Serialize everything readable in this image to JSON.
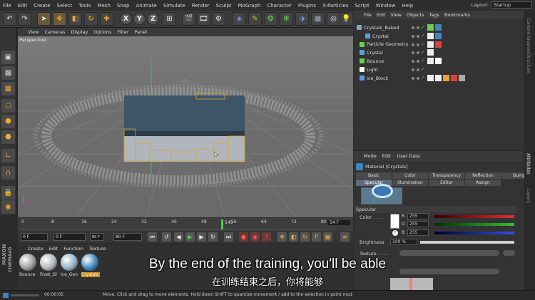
{
  "menubar": {
    "items": [
      "File",
      "Edit",
      "Create",
      "Select",
      "Tools",
      "Mesh",
      "Snap",
      "Animate",
      "Simulate",
      "Render",
      "Sculpt",
      "MoGraph",
      "Character",
      "Plugins",
      "X-Particles",
      "Script",
      "Window",
      "Help"
    ]
  },
  "layout": {
    "label": "Layout:",
    "value": "Startup"
  },
  "toolbar": {
    "x": "X",
    "y": "Y",
    "z": "Z"
  },
  "viewport": {
    "menu": [
      "View",
      "Cameras",
      "Display",
      "Options",
      "Filter",
      "Panel"
    ],
    "label": "Perspective"
  },
  "timeline": {
    "ticks": [
      "0",
      "8",
      "16",
      "24",
      "32",
      "40",
      "48",
      "56",
      "64",
      "72",
      "80"
    ],
    "marker": "545",
    "end_field": "54 F"
  },
  "playback": {
    "start": "0 F",
    "current": "0 F",
    "min": "80 F",
    "end": "80 F"
  },
  "material_manager": {
    "menu": [
      "Create",
      "Edit",
      "Function",
      "Texture"
    ],
    "materials": [
      {
        "name": "Bounce",
        "color": "#9a9a9a"
      },
      {
        "name": "Frost_Gl",
        "color": "#b0b6bc"
      },
      {
        "name": "Ice_Gen",
        "color": "#8fb1c8"
      },
      {
        "name": "Crystals",
        "color": "#3f86c0"
      }
    ]
  },
  "status": {
    "time": "00:00:05",
    "message": "Move: Click and drag to move elements. Hold down SHIFT to quantize movement / add to the selection in point mod"
  },
  "object_manager": {
    "menu": [
      "File",
      "Edit",
      "View",
      "Objects",
      "Tags",
      "Bookmarks"
    ],
    "objects": [
      {
        "name": "Crystals_Baked"
      },
      {
        "name": "Crystal"
      },
      {
        "name": "Particle Geometry"
      },
      {
        "name": "Crystal"
      },
      {
        "name": "Bounce"
      },
      {
        "name": "Light"
      },
      {
        "name": "Ice_Block"
      }
    ]
  },
  "attribute_manager": {
    "menu": [
      "Mode",
      "Edit",
      "User Data"
    ],
    "title": "Material [Crystals]",
    "tabs_row1": [
      "Basic",
      "Color",
      "Transparency",
      "Reflection",
      "Bump"
    ],
    "tabs_row2": [
      "Specular",
      "Illumination",
      "Editor",
      "Assign"
    ],
    "section": "Specular",
    "color_label": "Color . . . .",
    "r_label": "R",
    "r_value": "255",
    "g_label": "G",
    "g_value": "255",
    "b_label": "B",
    "b_value": "255",
    "brightness_label": "Brightness",
    "brightness_value": "100 %",
    "texture_label": "Texture . . . ."
  },
  "side_tabs": [
    "Content Browser",
    "Structure",
    "Attributes",
    "Layers"
  ],
  "subtitles": {
    "en": "By the end of the training, you'll be able",
    "zh": "在训练结束之后，你将能够"
  },
  "logo": {
    "line1": "MAXON",
    "line2": "CINEMA4D"
  }
}
